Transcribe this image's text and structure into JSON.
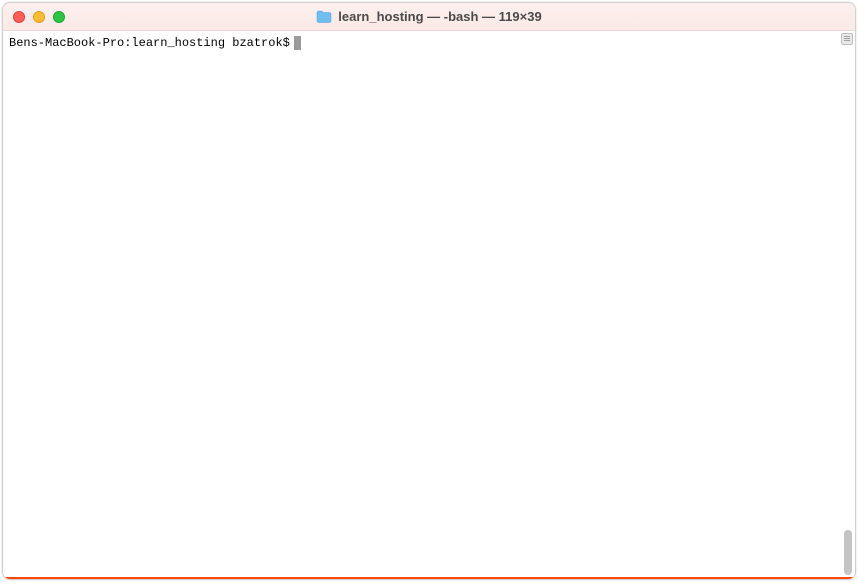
{
  "window": {
    "title": "learn_hosting — -bash — 119×39"
  },
  "terminal": {
    "prompt": "Bens-MacBook-Pro:learn_hosting bzatrok$"
  },
  "traffic_lights": {
    "close": "close-window",
    "minimize": "minimize-window",
    "maximize": "maximize-window"
  }
}
